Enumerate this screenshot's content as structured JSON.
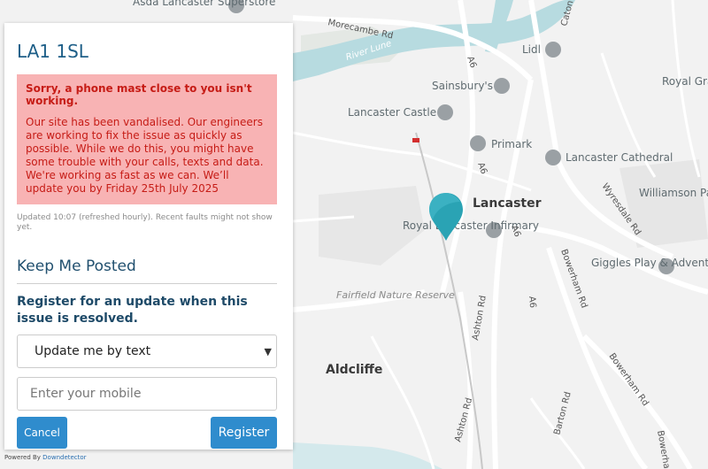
{
  "panel": {
    "postcode": "LA1 1SL",
    "alert_title": "Sorry, a phone mast close to you isn't working.",
    "alert_body": "Our site has been vandalised. Our engineers are working to fix the issue as quickly as possible. While we do this, you might have some trouble with your calls, texts and data. We're working as fast as we can. We’ll update you by Friday 25th July 2025",
    "updated_note": "Updated 10:07 (refreshed hourly). Recent faults might not show yet.",
    "section_title": "Keep Me Posted",
    "register_text": "Register for an update when this issue is resolved.",
    "update_method_selected": "Update me by text",
    "mobile_placeholder": "Enter your mobile",
    "cancel_label": "Cancel",
    "register_label": "Register"
  },
  "footer": {
    "powered_by_label": "Powered By",
    "powered_by_link": "Downdetector"
  },
  "map": {
    "labels": {
      "asda": "Asda Lancaster Superstore",
      "morecambe_rd": "Morecambe Rd",
      "river_lune": "River Lune",
      "caton_rd": "Caton Rd",
      "lidl": "Lidl",
      "a6_north": "A6",
      "sainsburys": "Sainsbury's",
      "royal_grammar": "Royal Grammar School War Memorial...",
      "lancaster_castle": "Lancaster Castle",
      "primark": "Primark",
      "lancaster_cathedral": "Lancaster Cathedral",
      "a6_mid": "A6",
      "wyresdale_rd": "Wyresdale Rd",
      "williamson_park": "Williamson Park",
      "lancaster": "Lancaster",
      "royal_infirmary": "Royal Lancaster Infirmary",
      "a6_east": "A6",
      "giggles": "Giggles Play & Adventure",
      "bowerham_rd": "Bowerham Rd",
      "fairfield": "Fairfield Nature Reserve",
      "ashton_rd": "Ashton Rd",
      "a6_south": "A6",
      "aldcliffe": "Aldcliffe",
      "bowerham_rd_2": "Bowerham Rd",
      "barton_rd": "Barton Rd",
      "ashton_rd_2": "Ashton Rd",
      "bowerham_3": "Bowerham"
    },
    "colors": {
      "land": "#f2f2f2",
      "water": "#b7dbe0",
      "road": "#ffffff",
      "pin": "#2aa3b4"
    }
  }
}
